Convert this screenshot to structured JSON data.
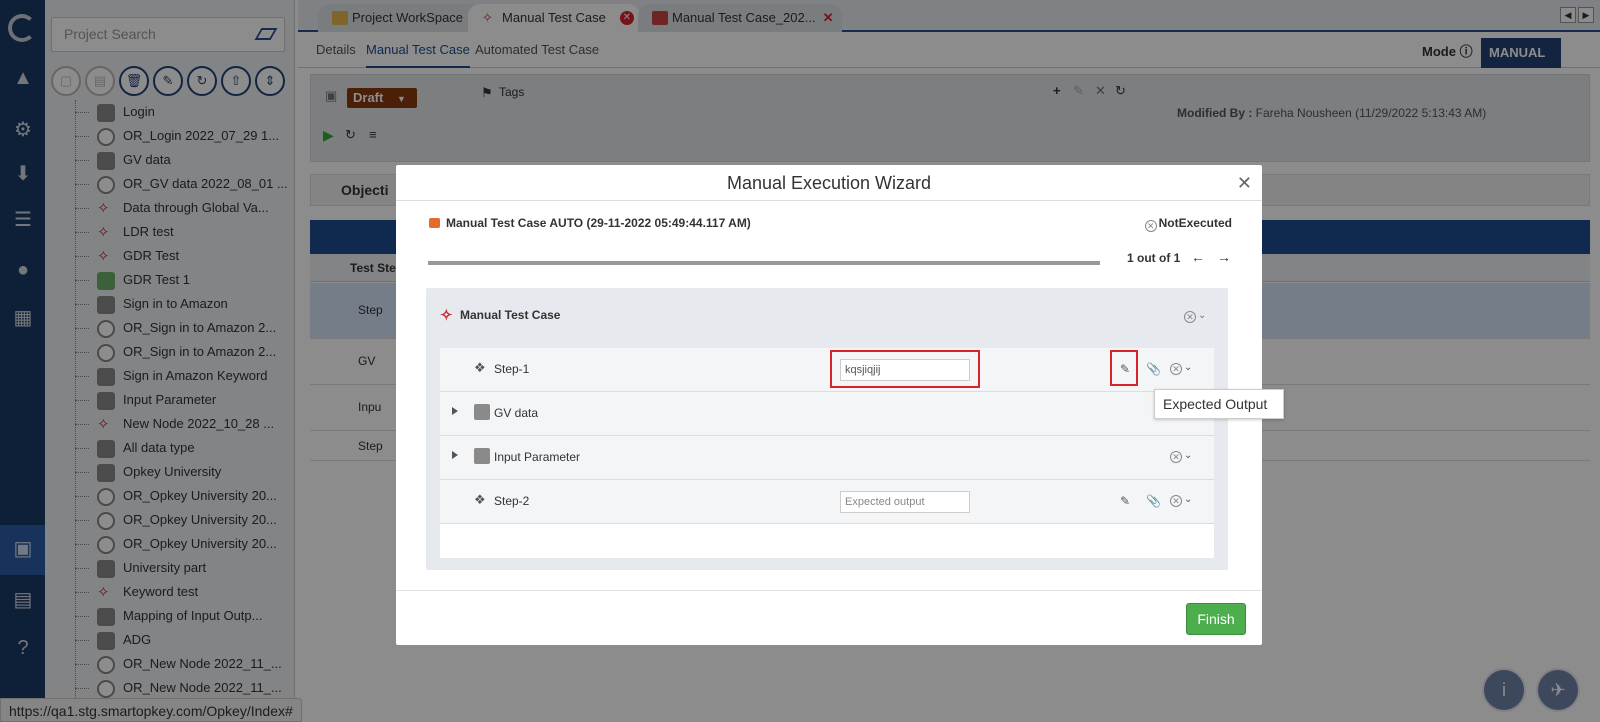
{
  "search": {
    "placeholder": "Project Search"
  },
  "tree": {
    "items": [
      {
        "label": "Login",
        "icon": "group"
      },
      {
        "label": "OR_Login 2022_07_29 1...",
        "icon": "or"
      },
      {
        "label": "GV data",
        "icon": "group"
      },
      {
        "label": "OR_GV data 2022_08_01 ...",
        "icon": "or"
      },
      {
        "label": "Data through Global Va...",
        "icon": "keyword"
      },
      {
        "label": "LDR test",
        "icon": "keyword"
      },
      {
        "label": "GDR Test",
        "icon": "keyword"
      },
      {
        "label": "GDR Test 1",
        "icon": "gdr"
      },
      {
        "label": "Sign in to Amazon",
        "icon": "group"
      },
      {
        "label": "OR_Sign in to Amazon 2...",
        "icon": "or"
      },
      {
        "label": "OR_Sign in to Amazon 2...",
        "icon": "or"
      },
      {
        "label": "Sign in Amazon Keyword",
        "icon": "group"
      },
      {
        "label": "Input Parameter",
        "icon": "group"
      },
      {
        "label": "New Node 2022_10_28 ...",
        "icon": "keyword"
      },
      {
        "label": "All data type",
        "icon": "group"
      },
      {
        "label": "Opkey University",
        "icon": "group"
      },
      {
        "label": "OR_Opkey University 20...",
        "icon": "or"
      },
      {
        "label": "OR_Opkey University 20...",
        "icon": "or"
      },
      {
        "label": "OR_Opkey University 20...",
        "icon": "or"
      },
      {
        "label": "University part",
        "icon": "group"
      },
      {
        "label": "Keyword test",
        "icon": "keyword"
      },
      {
        "label": "Mapping of Input Outp...",
        "icon": "group"
      },
      {
        "label": "ADG",
        "icon": "group"
      },
      {
        "label": "OR_New Node 2022_11_...",
        "icon": "or"
      },
      {
        "label": "OR_New Node 2022_11_...",
        "icon": "or"
      }
    ]
  },
  "status_url": "https://qa1.stg.smartopkey.com/Opkey/Index#",
  "tabs": [
    {
      "label": "Project WorkSpace"
    },
    {
      "label": "Manual Test Case"
    },
    {
      "label": "Manual Test Case_202..."
    }
  ],
  "subtabs": [
    {
      "label": "Details"
    },
    {
      "label": "Manual Test Case"
    },
    {
      "label": "Automated Test Case"
    }
  ],
  "mode": {
    "label": "Mode",
    "value": "MANUAL"
  },
  "props": {
    "status": "Draft",
    "tags_label": "Tags",
    "modified_label": "Modified By :",
    "modified_value": "Fareha Nousheen (11/29/2022 5:13:43 AM)"
  },
  "objective": {
    "label": "Objecti"
  },
  "grid": {
    "header": "Test Ste",
    "rows": [
      {
        "label": "Step"
      },
      {
        "label": "GV"
      },
      {
        "label": "Inpu"
      },
      {
        "label": "Step"
      }
    ]
  },
  "wizard": {
    "title": "Manual Execution Wizard",
    "case_title": "Manual Test Case AUTO (29-11-2022 05:49:44.117 AM)",
    "status": "NotExecuted",
    "progress_fraction": 1.0,
    "page_count": "1 out of 1",
    "group_title": "Manual Test Case",
    "steps": [
      {
        "label": "Step-1",
        "type": "step",
        "value": "kqsjiqjij",
        "placeholder": "Expected output",
        "highlighted": true
      },
      {
        "label": "GV data",
        "type": "group"
      },
      {
        "label": "Input Parameter",
        "type": "group"
      },
      {
        "label": "Step-2",
        "type": "step",
        "value": "",
        "placeholder": "Expected output",
        "highlighted": false
      }
    ],
    "tooltip": "Expected Output",
    "finish_label": "Finish"
  },
  "colors": {
    "primary": "#24437a",
    "highlight": "#d9232a",
    "finish": "#4cae4c",
    "draft": "#8b3a12"
  }
}
